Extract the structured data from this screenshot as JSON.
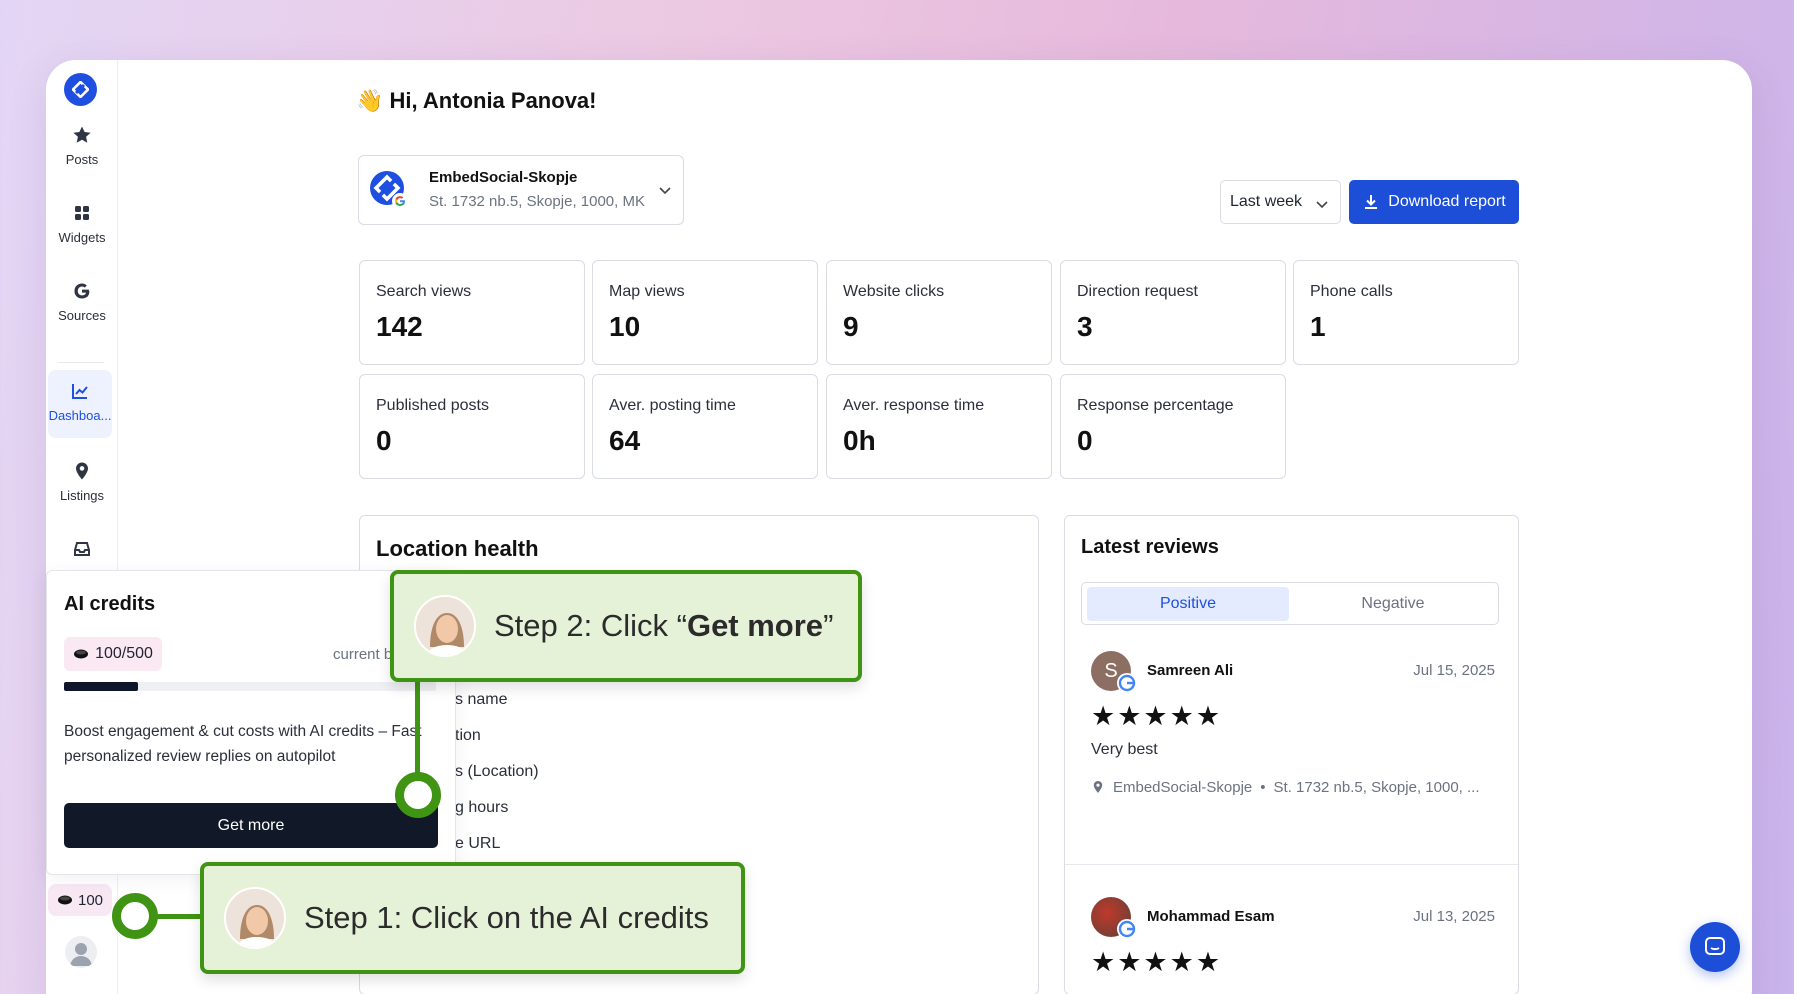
{
  "greeting": "👋 Hi, Antonia Panova!",
  "sidebar": {
    "items": [
      {
        "label": "Posts",
        "icon": "star-icon"
      },
      {
        "label": "Widgets",
        "icon": "widgets-icon"
      },
      {
        "label": "Sources",
        "icon": "google-icon"
      },
      {
        "label": "Dashboa...",
        "icon": "chart-icon",
        "active": true
      },
      {
        "label": "Listings",
        "icon": "location-pin-icon"
      }
    ],
    "credits": "100"
  },
  "location": {
    "name": "EmbedSocial-Skopje",
    "address": "St. 1732 nb.5, Skopje, 1000, MK"
  },
  "period": "Last week",
  "download_label": "Download report",
  "metrics": [
    {
      "label": "Search views",
      "value": "142"
    },
    {
      "label": "Map views",
      "value": "10"
    },
    {
      "label": "Website clicks",
      "value": "9"
    },
    {
      "label": "Direction request",
      "value": "3"
    },
    {
      "label": "Phone calls",
      "value": "1"
    },
    {
      "label": "Published posts",
      "value": "0"
    },
    {
      "label": "Aver. posting time",
      "value": "64"
    },
    {
      "label": "Aver. response time",
      "value": "0h"
    },
    {
      "label": "Response percentage",
      "value": "0"
    }
  ],
  "location_health": {
    "title": "Location health",
    "items": [
      "s name",
      "tion",
      "s (Location)",
      "g hours",
      "e URL"
    ]
  },
  "reviews": {
    "title": "Latest reviews",
    "tabs": {
      "positive": "Positive",
      "negative": "Negative"
    },
    "items": [
      {
        "initial": "S",
        "name": "Samreen Ali",
        "date": "Jul 15, 2025",
        "stars": "★★★★★",
        "text": "Very best",
        "location": "EmbedSocial-Skopje",
        "address": "St. 1732 nb.5, Skopje, 1000, ..."
      },
      {
        "name": "Mohammad Esam",
        "date": "Jul 13, 2025",
        "stars": "★★★★★"
      }
    ]
  },
  "ai_credits": {
    "title": "AI credits",
    "badge": "100/500",
    "current": "current b",
    "progress_fraction": 0.2,
    "description": "Boost engagement & cut costs with AI credits – Fast personalized review replies on autopilot",
    "button": "Get more"
  },
  "steps": {
    "step1": "Step 1: Click on the AI credits",
    "step2_prefix": "Step 2: Click “",
    "step2_bold": "Get more",
    "step2_suffix": "”"
  },
  "colors": {
    "accent": "#1d4ed8",
    "callout_green": "#3f9413",
    "callout_bg": "#e6f2d8"
  }
}
